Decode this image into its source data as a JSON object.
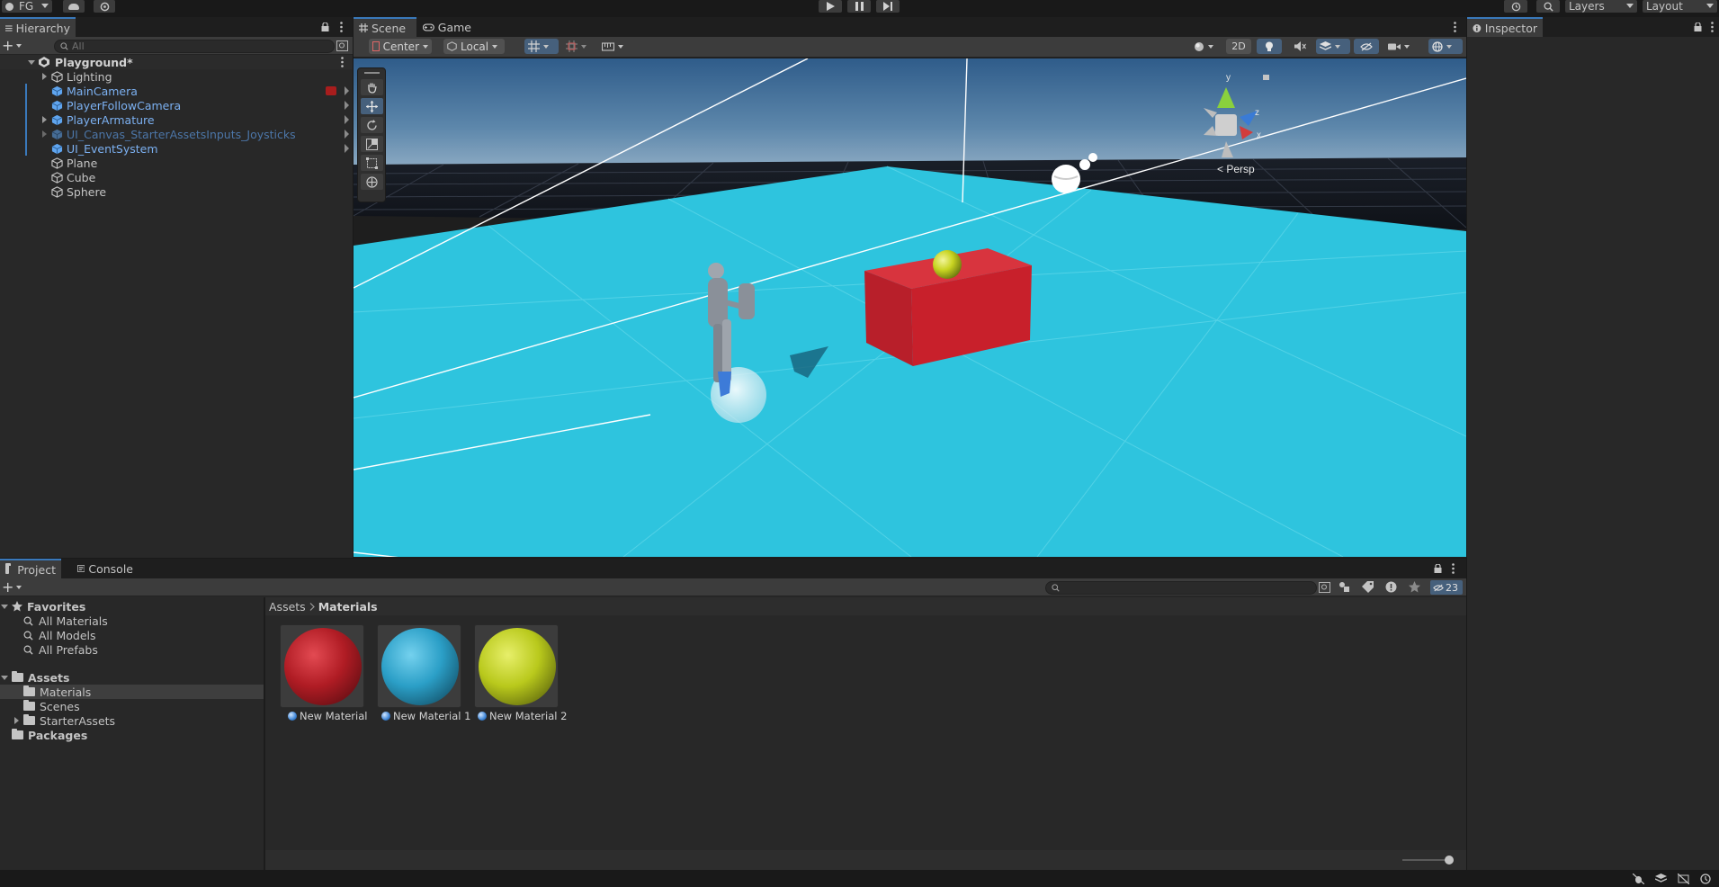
{
  "topbar": {
    "account_label": "FG",
    "layers_label": "Layers",
    "layout_label": "Layout"
  },
  "hierarchy": {
    "tab_label": "Hierarchy",
    "search_placeholder": "All",
    "scene_name": "Playground*",
    "items": [
      {
        "label": "Lighting",
        "style": "normal",
        "foldable": true
      },
      {
        "label": "MainCamera",
        "style": "prefab",
        "foldable": false
      },
      {
        "label": "PlayerFollowCamera",
        "style": "prefab",
        "foldable": false
      },
      {
        "label": "PlayerArmature",
        "style": "prefab",
        "foldable": true
      },
      {
        "label": "UI_Canvas_StarterAssetsInputs_Joysticks",
        "style": "prefab-inactive",
        "foldable": true
      },
      {
        "label": "UI_EventSystem",
        "style": "prefab",
        "foldable": false
      },
      {
        "label": "Plane",
        "style": "normal",
        "foldable": false
      },
      {
        "label": "Cube",
        "style": "normal",
        "foldable": false
      },
      {
        "label": "Sphere",
        "style": "normal",
        "foldable": false
      }
    ]
  },
  "scene": {
    "tabs": [
      "Scene",
      "Game"
    ],
    "pivot_label": "Center",
    "space_label": "Local",
    "mode_2d_label": "2D",
    "gizmo_projection": "Persp",
    "gizmo_axes": {
      "y": "y",
      "z": "z",
      "x": "x"
    }
  },
  "inspector": {
    "tab_label": "Inspector"
  },
  "project": {
    "tabs": [
      "Project",
      "Console"
    ],
    "favorites_label": "Favorites",
    "favorites": [
      "All Materials",
      "All Models",
      "All Prefabs"
    ],
    "assets_label": "Assets",
    "asset_folders": [
      "Materials",
      "Scenes",
      "StarterAssets"
    ],
    "packages_label": "Packages",
    "breadcrumb": [
      "Assets",
      "Materials"
    ],
    "hidden_count": "23",
    "materials": [
      {
        "name": "New Material",
        "color": "#b01c24"
      },
      {
        "name": "New Material 1",
        "color": "#2b9fc7"
      },
      {
        "name": "New Material 2",
        "color": "#b9c91c"
      }
    ]
  },
  "colors": {
    "accent": "#3a79bb",
    "prefab_text": "#7cb1f2",
    "ground": "#2ec4de",
    "cube": "#c8202b",
    "sphere": "#c8d421"
  }
}
